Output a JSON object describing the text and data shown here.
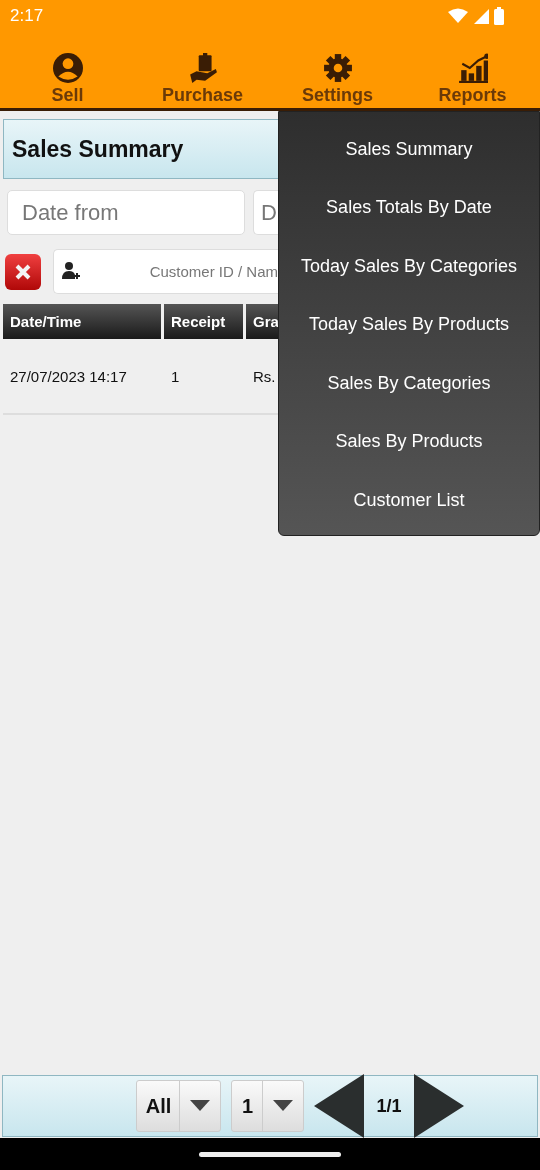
{
  "status_bar": {
    "time": "2:17"
  },
  "tabs": [
    {
      "label": "Sell"
    },
    {
      "label": "Purchase"
    },
    {
      "label": "Settings"
    },
    {
      "label": "Reports"
    }
  ],
  "page_title": "Sales Summary",
  "filters": {
    "date_from": {
      "placeholder": "Date from"
    },
    "date_to": {
      "placeholder": "D"
    },
    "customer": {
      "placeholder": "Customer ID / Nam"
    }
  },
  "table": {
    "columns": [
      "Date/Time",
      "Receipt",
      "Gra"
    ],
    "rows": [
      [
        "27/07/2023 14:17",
        "1",
        "Rs."
      ]
    ]
  },
  "menu": {
    "items": [
      "Sales Summary",
      "Sales Totals By Date",
      "Today Sales By Categories",
      "Today Sales By Products",
      "Sales By Categories",
      "Sales By Products",
      "Customer List"
    ]
  },
  "footer": {
    "filter": "All",
    "page_select": "1",
    "page_info": "1/1"
  }
}
